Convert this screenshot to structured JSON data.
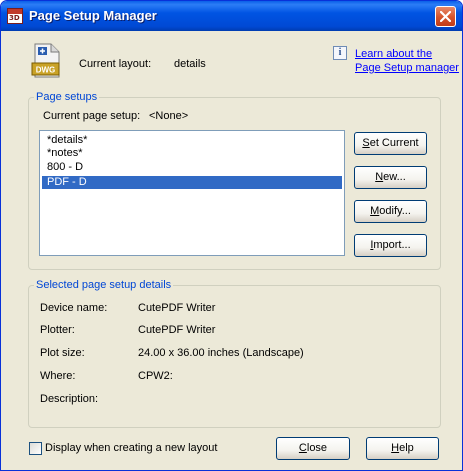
{
  "window": {
    "title": "Page Setup Manager",
    "app_icon_text": "3D"
  },
  "header": {
    "current_layout_label": "Current layout:",
    "current_layout_value": "details",
    "learn_link_line1": "Learn about the",
    "learn_link_line2": "Page Setup manager",
    "file_icon_text": "DWG"
  },
  "page_setups": {
    "group_title": "Page setups",
    "current_label": "Current page setup:",
    "current_value": "<None>",
    "items": [
      "*details*",
      "*notes*",
      "800 - D",
      "PDF - D"
    ],
    "selected_index": 3
  },
  "buttons": {
    "set_current": {
      "prefix": "",
      "key": "S",
      "rest": "et Current"
    },
    "new": {
      "prefix": "",
      "key": "N",
      "rest": "ew..."
    },
    "modify": {
      "prefix": "",
      "key": "M",
      "rest": "odify..."
    },
    "import": {
      "prefix": "",
      "key": "I",
      "rest": "mport..."
    },
    "close": {
      "prefix": "",
      "key": "C",
      "rest": "lose"
    },
    "help": {
      "prefix": "",
      "key": "H",
      "rest": "elp"
    }
  },
  "details": {
    "group_title": "Selected page setup details",
    "device_name_label": "Device name:",
    "device_name_value": "CutePDF Writer",
    "plotter_label": "Plotter:",
    "plotter_value": "CutePDF Writer",
    "plot_size_label": "Plot size:",
    "plot_size_value": "24.00 x 36.00 inches (Landscape)",
    "where_label": "Where:",
    "where_value": "CPW2:",
    "description_label": "Description:",
    "description_value": ""
  },
  "footer": {
    "checkbox_label": "Display when creating a new layout",
    "checkbox_checked": false
  },
  "colors": {
    "titlebar": "#0054e3",
    "dialog_bg": "#ece9d8",
    "group_title": "#0046d5",
    "selection": "#316ac5",
    "link": "#0000ff"
  }
}
